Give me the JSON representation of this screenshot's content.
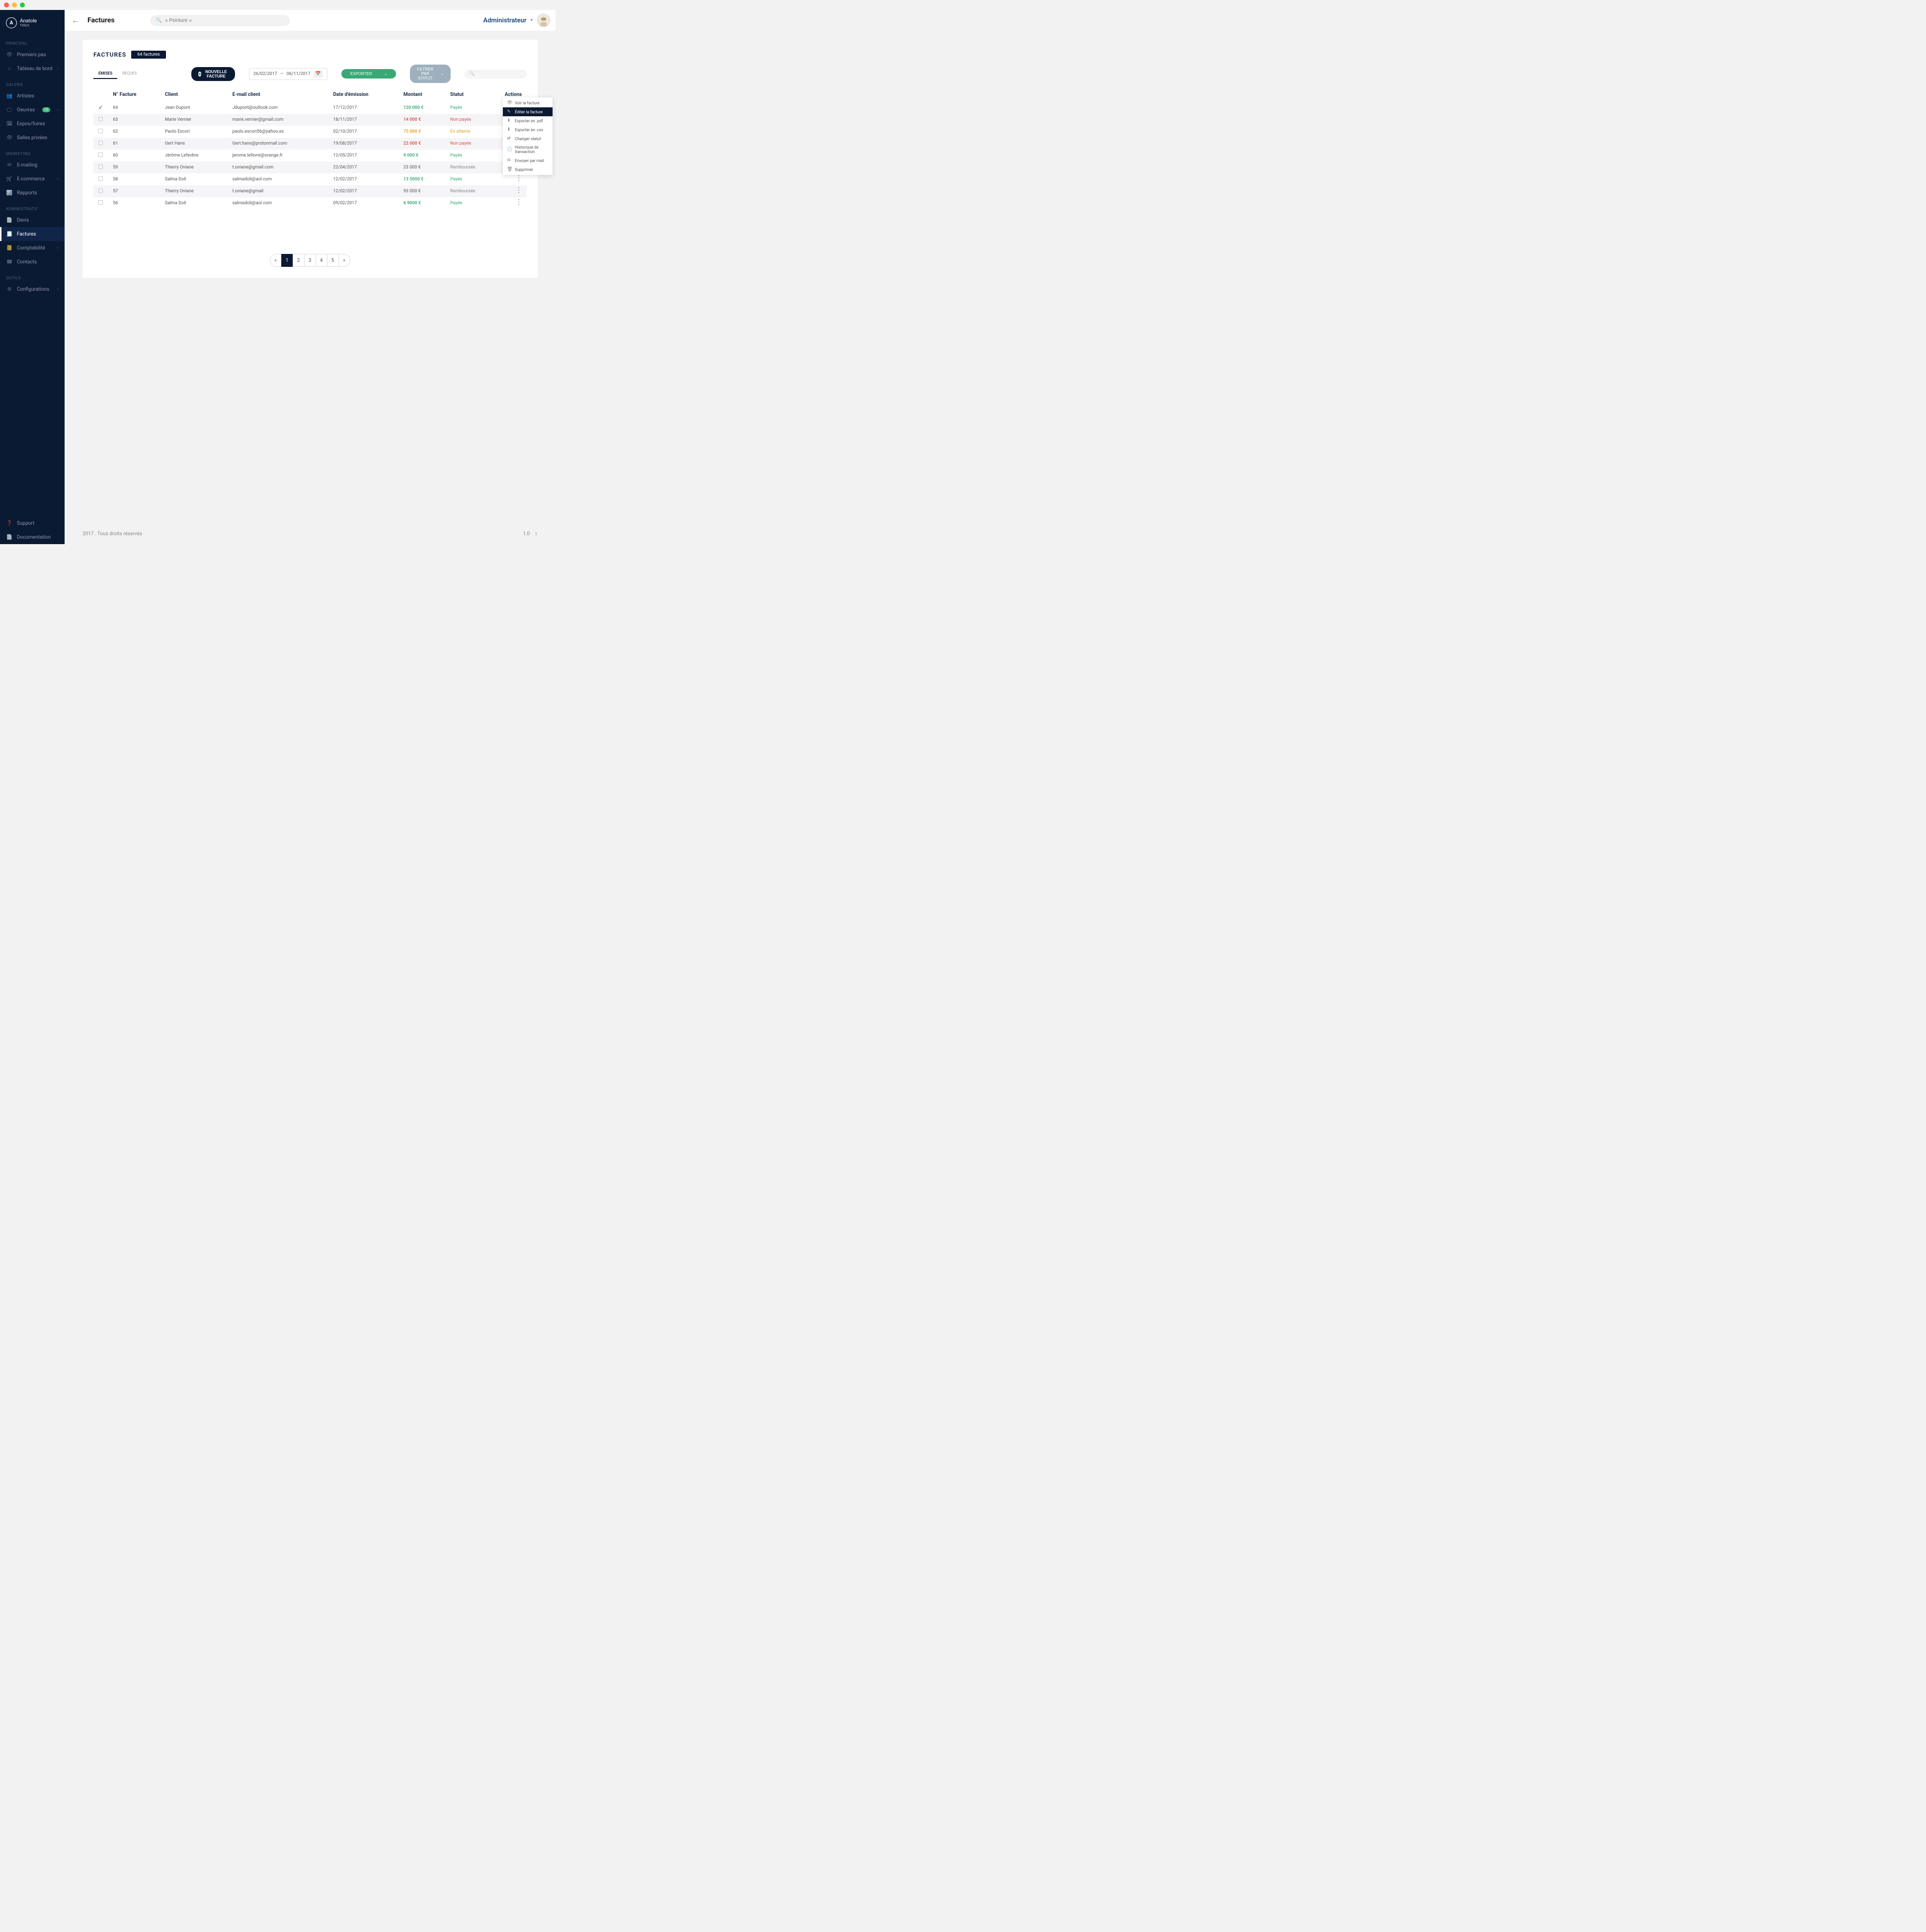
{
  "brand": {
    "name": "Anatole",
    "sub": "TOOLS",
    "letter": "A"
  },
  "sidebar": {
    "groups": [
      {
        "title": "PRINCIPAL",
        "items": [
          {
            "label": "Premiers pas",
            "icon": "eye"
          },
          {
            "label": "Tableau de bord",
            "icon": "home",
            "chevron": true
          }
        ]
      },
      {
        "title": "GALERIE",
        "items": [
          {
            "label": "Artistes",
            "icon": "users"
          },
          {
            "label": "Oeuvres",
            "icon": "monitor",
            "badge": "15",
            "chevron": true
          },
          {
            "label": "Expos/foires",
            "icon": "calendar"
          },
          {
            "label": "Salles privées",
            "icon": "eye"
          }
        ]
      },
      {
        "title": "MARKETING",
        "items": [
          {
            "label": "E-mailing",
            "icon": "mail"
          },
          {
            "label": "E-commerce",
            "icon": "cart",
            "chevron": true
          },
          {
            "label": "Rapports",
            "icon": "bars"
          }
        ]
      },
      {
        "title": "ADMINISTRATIF",
        "items": [
          {
            "label": "Devis",
            "icon": "file"
          },
          {
            "label": "Factures",
            "icon": "invoice",
            "active": true
          },
          {
            "label": "Comptabilité",
            "icon": "book",
            "chevron": true
          },
          {
            "label": "Contacts",
            "icon": "contact"
          }
        ]
      },
      {
        "title": "OUTILS",
        "items": [
          {
            "label": "Configurations",
            "icon": "gear",
            "chevron": true
          }
        ]
      }
    ],
    "bottom": [
      {
        "label": "Support",
        "icon": "help"
      },
      {
        "label": "Documentation",
        "icon": "doc"
      }
    ]
  },
  "topbar": {
    "title": "Factures",
    "searchPlaceholder": "« Peinture »",
    "userRole": "Administrateur"
  },
  "panel": {
    "title": "FACTURES",
    "countLabel": "64 factures",
    "tabs": [
      {
        "label": "EMISES",
        "active": true
      },
      {
        "label": "REÇUES",
        "active": false
      }
    ],
    "newBtn": "NOUVELLE FACTURE",
    "dateRange": {
      "from": "26/02/2017",
      "sep": "—",
      "to": "06/11/2017"
    },
    "exportBtn": "EXPORTER",
    "filterBtn": "FILTRER PAR STATUT"
  },
  "table": {
    "headers": {
      "num": "N° Facture",
      "client": "Client",
      "email": "E-mail client",
      "date": "Date d'émission",
      "amount": "Montant",
      "status": "Statut",
      "actions": "Actions"
    },
    "rows": [
      {
        "checked": true,
        "num": "64",
        "client": "Jean Dupont",
        "email": "Jdupont@outlook.com",
        "date": "17/12/2017",
        "amount": "120 000 €",
        "amtClass": "green",
        "status": "Payée",
        "statusClass": "green"
      },
      {
        "checked": false,
        "num": "63",
        "client": "Marie Vernier",
        "email": "marie.vernier@gmail.com",
        "date": "18/11/2017",
        "amount": "14 000 €",
        "amtClass": "red",
        "status": "Non payée",
        "statusClass": "red"
      },
      {
        "checked": false,
        "num": "62",
        "client": "Paolo Escori",
        "email": "paolo.escori56@yahoo.es",
        "date": "02/10/2017",
        "amount": "75 000 €",
        "amtClass": "orange",
        "status": "En attente",
        "statusClass": "orange"
      },
      {
        "checked": false,
        "num": "61",
        "client": "Gert Hans",
        "email": "Gert.hans@protonmail.com",
        "date": "19/08/2017",
        "amount": "22 000 €",
        "amtClass": "red",
        "status": "Non payée",
        "statusClass": "red"
      },
      {
        "checked": false,
        "num": "60",
        "client": "Jérôme Lefevbre",
        "email": "jerome.lefevre@orange.fr",
        "date": "12/05/2017",
        "amount": "9 000 €",
        "amtClass": "green",
        "status": "Payée",
        "statusClass": "green"
      },
      {
        "checked": false,
        "num": "59",
        "client": "Thierry Oniane",
        "email": "t.oniane@gmail.com",
        "date": "22/04/2017",
        "amount": "23 000 €",
        "amtClass": "grey",
        "status": "Remboursée",
        "statusClass": "grey"
      },
      {
        "checked": false,
        "num": "58",
        "client": "Salma Doli",
        "email": "salmadoli@aol.com",
        "date": "12/02/2017",
        "amount": "13 5000 €",
        "amtClass": "green",
        "status": "Payée",
        "statusClass": "green"
      },
      {
        "checked": false,
        "num": "57",
        "client": "Thierry Oniane",
        "email": "t.oniane@gmail",
        "date": "12/02/2017",
        "amount": "93 000 €",
        "amtClass": "grey",
        "status": "Remboursée",
        "statusClass": "grey"
      },
      {
        "checked": false,
        "num": "56",
        "client": "Salma Doli",
        "email": "salmadoli@aol.com",
        "date": "09/02/2017",
        "amount": "6 9000 €",
        "amtClass": "green",
        "status": "Payée",
        "statusClass": "green"
      }
    ]
  },
  "contextMenu": [
    {
      "icon": "eye",
      "label": "Voir la facture",
      "active": false
    },
    {
      "icon": "edit",
      "label": "Éditer la facture",
      "active": true
    },
    {
      "icon": "pdf",
      "label": "Exporter en .pdf",
      "active": false
    },
    {
      "icon": "csv",
      "label": "Exporter en .csv",
      "active": false
    },
    {
      "icon": "swap",
      "label": "Changer statut",
      "active": false
    },
    {
      "icon": "hist",
      "label": "Historique de transaction",
      "active": false
    },
    {
      "icon": "send",
      "label": "Envoyer par mail",
      "active": false
    },
    {
      "icon": "trash",
      "label": "Supprimer",
      "active": false
    }
  ],
  "pagination": {
    "prev": "«",
    "pages": [
      "1",
      "2",
      "3",
      "4",
      "5"
    ],
    "activeIndex": 0,
    "next": "»"
  },
  "footer": {
    "left": "2017 . Tous droits réservés",
    "version": "1.0"
  }
}
